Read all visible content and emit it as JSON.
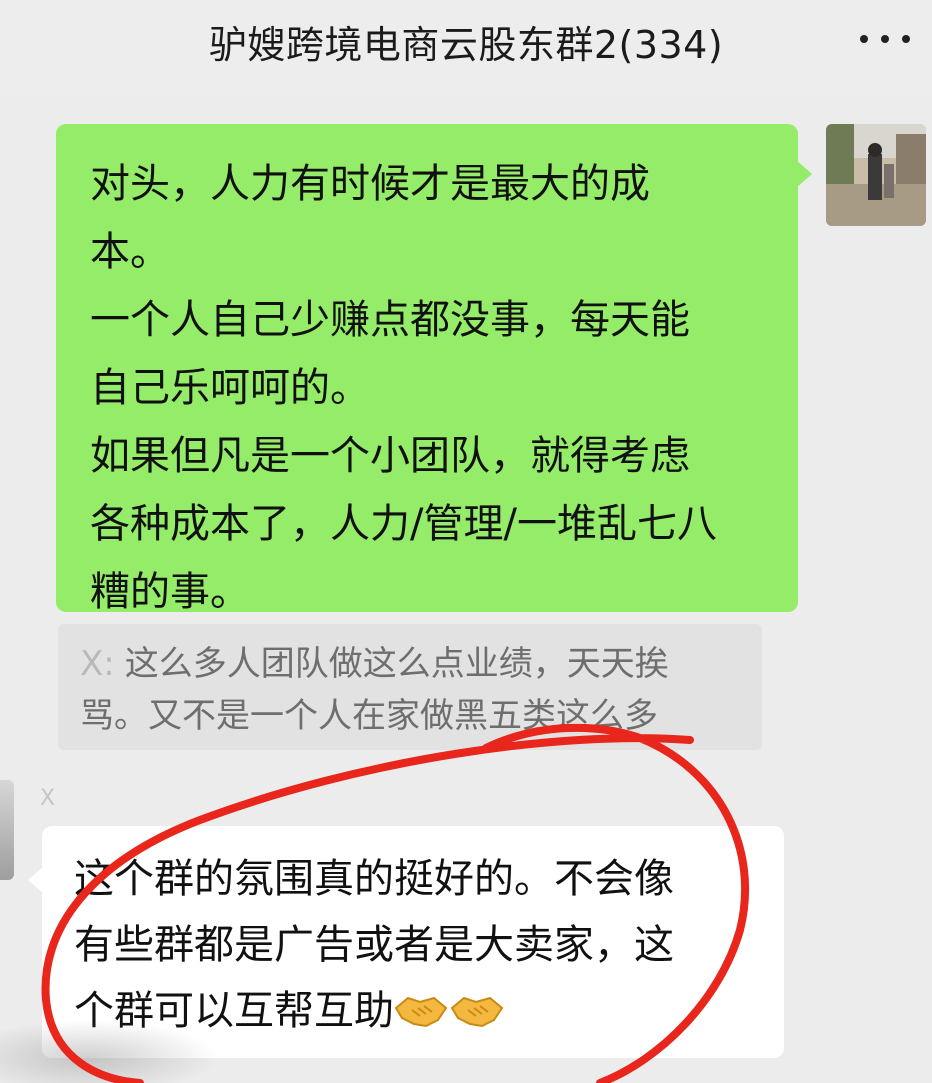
{
  "header": {
    "title": "驴嫂跨境电商云股东群2(334)",
    "more_icon": "more-dots-icon"
  },
  "messages": [
    {
      "side": "right",
      "type": "text",
      "text": "对头，人力有时候才是最大的成\n本。\n一个人自己少赚点都没事，每天能\n自己乐呵呵的。\n如果但凡是一个小团队，就得考虑\n各种成本了，人力/管理/一堆乱七八\n糟的事。",
      "bubble_color": "#95ec69",
      "avatar_icon": "user-avatar-photo"
    },
    {
      "side": "right",
      "type": "quote",
      "sender": "X:",
      "text": "这么多人团队做这么点业绩，天天挨\n骂。又不是一个人在家做黑五类这么多"
    },
    {
      "side": "left",
      "type": "text",
      "sender_hint": "X",
      "text": "这个群的氛围真的挺好的。不会像\n有些群都是广告或者是大卖家，这\n个群可以互帮互助",
      "emoji": [
        "handshake-icon",
        "handshake-icon"
      ],
      "bubble_color": "#ffffff"
    }
  ],
  "annotation": {
    "type": "red-hand-drawn-circle",
    "color": "#e8261b"
  }
}
